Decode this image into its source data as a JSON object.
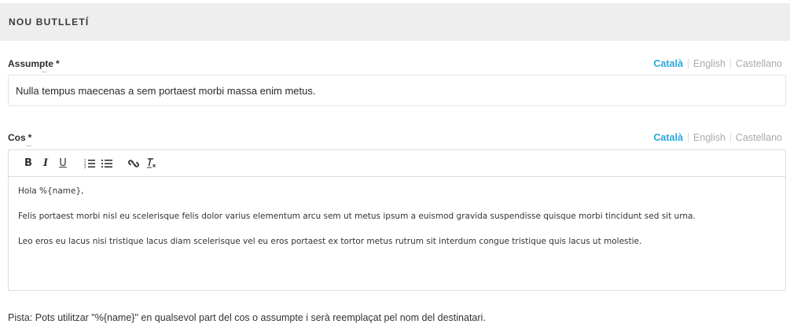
{
  "header": {
    "title": "NOU BUTLLETÍ"
  },
  "languages": [
    "Català",
    "English",
    "Castellano"
  ],
  "subject": {
    "label": "Assumpte",
    "required_mark": "*",
    "value": "Nulla tempus maecenas a sem portaest morbi massa enim metus."
  },
  "body": {
    "label": "Cos",
    "required_mark": "*",
    "toolbar": [
      {
        "name": "bold-button",
        "glyph": "B"
      },
      {
        "name": "italic-button",
        "glyph": "I"
      },
      {
        "name": "underline-button",
        "glyph": "U"
      },
      {
        "name": "ordered-list-button",
        "icon": "ordered-list-icon"
      },
      {
        "name": "bullet-list-button",
        "icon": "bullet-list-icon"
      },
      {
        "name": "link-button",
        "icon": "link-icon"
      },
      {
        "name": "clear-format-button",
        "glyph": "Tx"
      }
    ],
    "paragraphs": [
      "Hola %{name},",
      "Felis portaest morbi nisl eu scelerisque felis dolor varius elementum arcu sem ut metus ipsum a euismod gravida suspendisse quisque morbi tincidunt sed sit urna.",
      "Leo eros eu lacus nisi tristique lacus diam scelerisque vel eu eros portaest ex tortor metus rutrum sit interdum congue tristique quis lacus ut molestie."
    ]
  },
  "hint": "Pista: Pots utilitzar \"%{name}\" en qualsevol part del cos o assumpte i serà reemplaçat pel nom del destinatari.",
  "colors": {
    "accent": "#2aa7d8",
    "inactive_lang": "#aaaaaa",
    "header_bg": "#eeeeee"
  }
}
